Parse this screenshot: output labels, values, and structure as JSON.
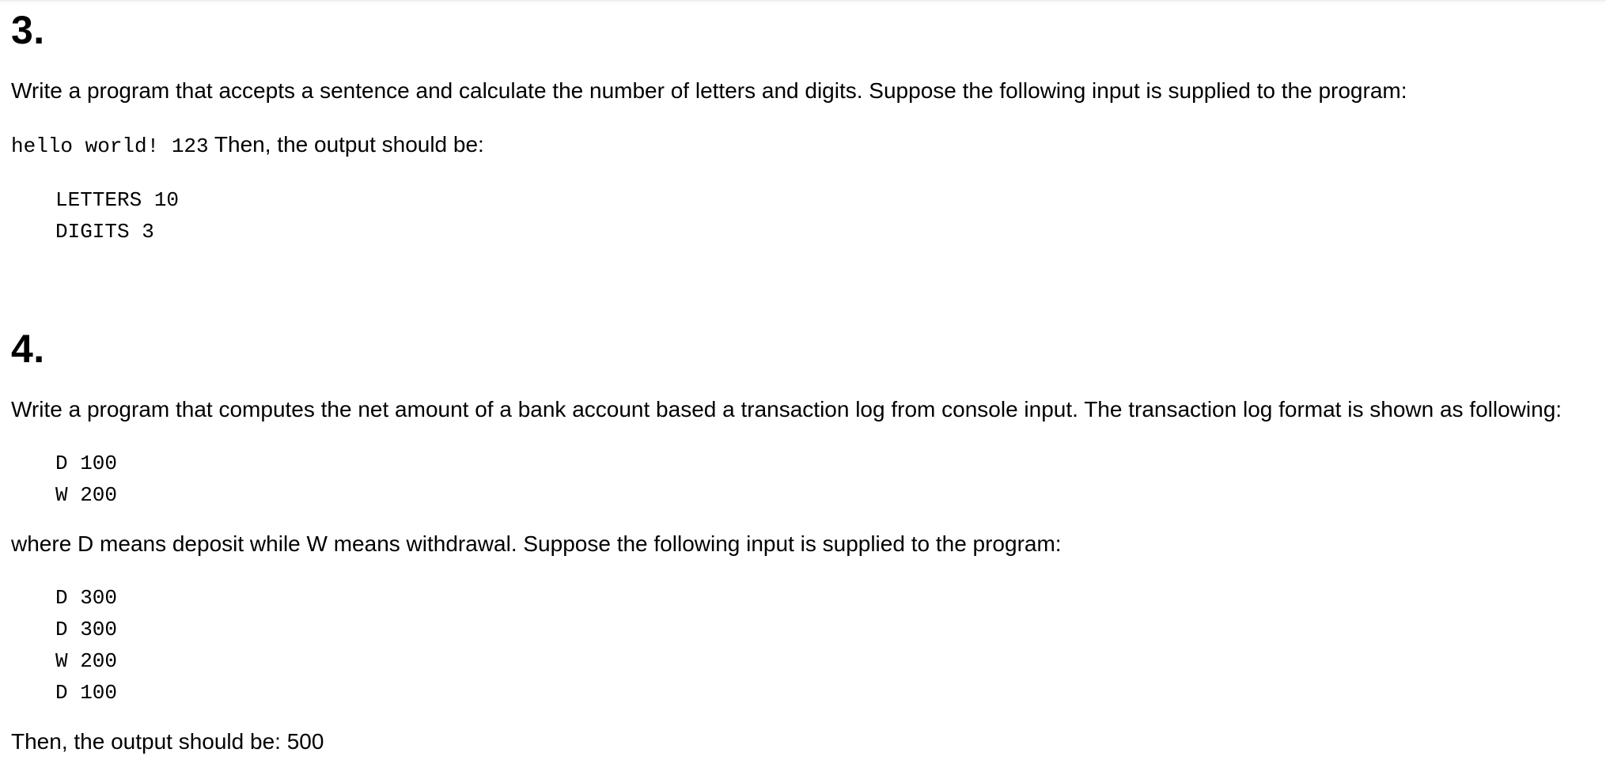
{
  "sections": [
    {
      "number": "3.",
      "intro": "Write a program that accepts a sentence and calculate the number of letters and digits. Suppose the following input is supplied to the program:",
      "example_input": "hello world! 123",
      "output_intro": " Then, the output should be:",
      "output_lines": [
        "LETTERS 10",
        "DIGITS 3"
      ]
    },
    {
      "number": "4.",
      "intro": "Write a program that computes the net amount of a bank account based a transaction log from console input. The transaction log format is shown as following:",
      "format_lines": [
        "D 100",
        "W 200"
      ],
      "explanation": "where D means deposit while W means withdrawal. Suppose the following input is supplied to the program:",
      "input_lines": [
        "D 300",
        "D 300",
        "W 200",
        "D 100"
      ],
      "conclusion": "Then, the output should be: 500"
    }
  ]
}
